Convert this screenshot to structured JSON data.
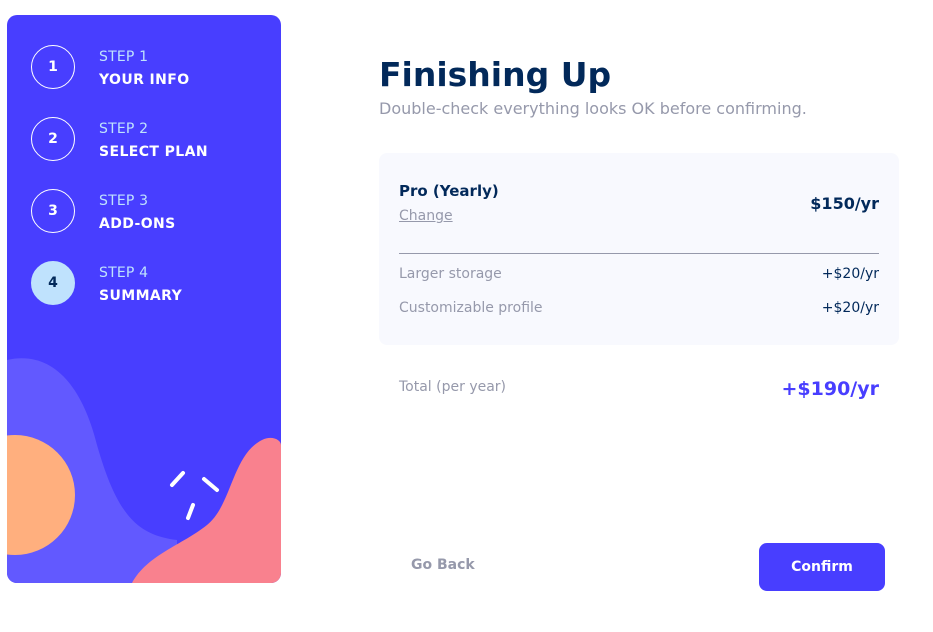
{
  "colors": {
    "sidebar_bg": "#483eff",
    "accent": "#483eff",
    "active_step": "#bfe2fd",
    "deco_wave": "#6259ff",
    "deco_circle": "#ffaf7e",
    "deco_blob": "#f9818e",
    "text_dark": "#02295a",
    "text_gray": "#9699ab"
  },
  "steps": [
    {
      "number": "1",
      "label": "STEP 1",
      "title": "YOUR INFO",
      "active": false
    },
    {
      "number": "2",
      "label": "STEP 2",
      "title": "SELECT PLAN",
      "active": false
    },
    {
      "number": "3",
      "label": "STEP 3",
      "title": "ADD-ONS",
      "active": false
    },
    {
      "number": "4",
      "label": "STEP 4",
      "title": "SUMMARY",
      "active": true
    }
  ],
  "main": {
    "title": "Finishing Up",
    "subtitle": "Double-check everything looks OK before confirming."
  },
  "summary": {
    "plan_name": "Pro (Yearly)",
    "change_label": "Change",
    "plan_price": "$150/yr",
    "addons": [
      {
        "name": "Larger storage",
        "price": "+$20/yr"
      },
      {
        "name": "Customizable profile",
        "price": "+$20/yr"
      }
    ],
    "total_label": "Total (per year)",
    "total_price": "+$190/yr"
  },
  "actions": {
    "back_label": "Go Back",
    "confirm_label": "Confirm"
  }
}
